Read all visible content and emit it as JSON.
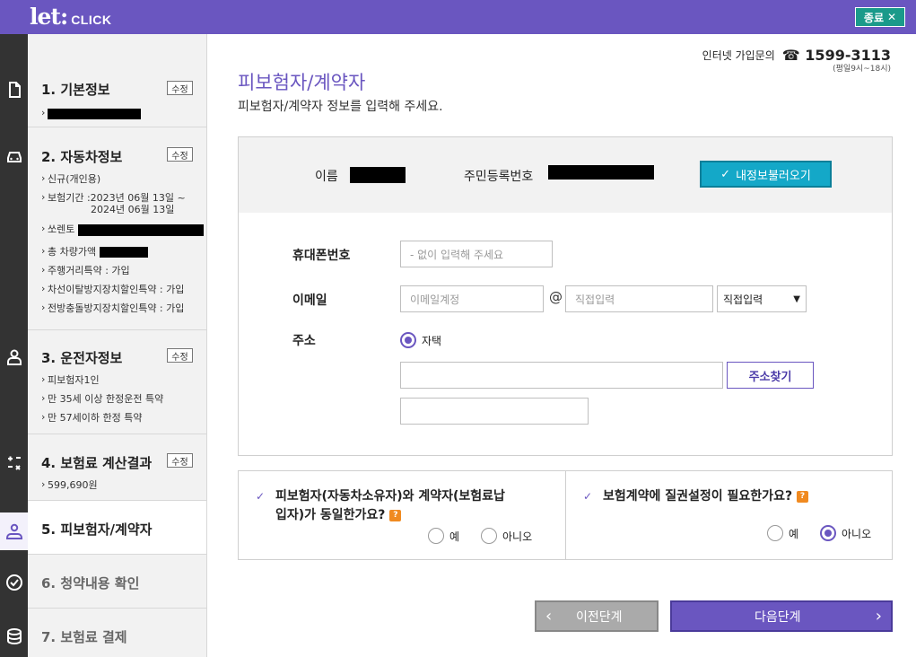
{
  "header": {
    "logo_let": "let:",
    "logo_click": "CLICK",
    "close_label": "종료"
  },
  "sidebar": {
    "sections": [
      {
        "title": "1. 기본정보",
        "edit": "수정",
        "items": []
      },
      {
        "title": "2. 자동차정보",
        "edit": "수정",
        "items": [
          "신규(개인용)",
          "보험기간 :2023년 06월 13일 ~",
          "2024년 06월 13일",
          "쏘렌토",
          "총 차량가액",
          "주행거리특약 : 가입",
          "차선이탈방지장치할인특약 : 가입",
          "전방충돌방지장치할인특약 : 가입"
        ]
      },
      {
        "title": "3. 운전자정보",
        "edit": "수정",
        "items": [
          "피보험자1인",
          "만 35세 이상 한정운전 특약",
          "만 57세이하 한정 특약"
        ]
      },
      {
        "title": "4. 보험료 계산결과",
        "edit": "수정",
        "items": [
          "599,690원"
        ]
      },
      {
        "title": "5. 피보험자/계약자"
      },
      {
        "title": "6. 청약내용 확인"
      },
      {
        "title": "7. 보험료 결제"
      }
    ]
  },
  "contact": {
    "label": "인터넷 가입문의",
    "phone": "1599-3113",
    "hours": "(평일9시~18시)"
  },
  "main": {
    "title": "피보험자/계약자",
    "subtitle": "피보험자/계약자 정보를 입력해 주세요.",
    "name_label": "이름",
    "rrn_label": "주민등록번호",
    "load_button": "내정보불러오기",
    "phone_label": "휴대폰번호",
    "phone_placeholder": "- 없이 입력해 주세요",
    "email_label": "이메일",
    "email_id_placeholder": "이메일계정",
    "email_at": "@",
    "email_domain_placeholder": "직접입력",
    "email_domain_select": "직접입력",
    "address_label": "주소",
    "address_type": "자택",
    "address_search": "주소찾기"
  },
  "questions": {
    "q1_line1": "피보험자(자동차소유자)와 계약자(보험료납",
    "q1_line2": "입자)가 동일한가요?",
    "q2": "보험계약에 질권설정이 필요한가요?",
    "yes": "예",
    "no": "아니오",
    "q1_selected": "none",
    "q2_selected": "아니오"
  },
  "nav": {
    "prev": "이전단계",
    "next": "다음단계"
  },
  "colors": {
    "brand": "#6a56c0",
    "accent": "#14a8c8",
    "close": "#1a9a8a"
  }
}
